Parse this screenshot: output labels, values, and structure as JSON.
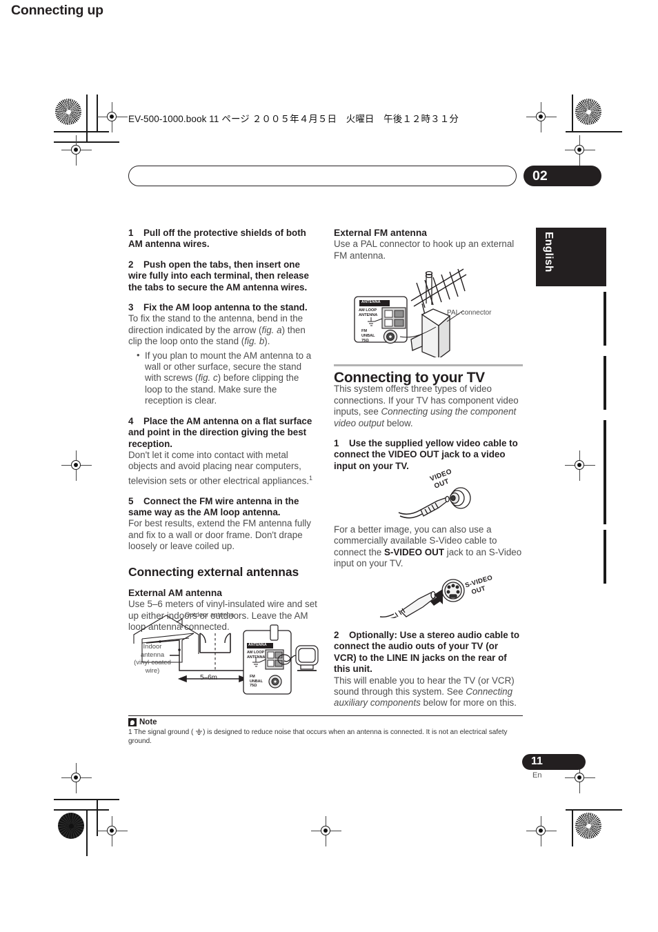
{
  "file_header": "EV-500-1000.book  11 ページ  ２００５年４月５日　火曜日　午後１２時３１分",
  "banner": {
    "title": "Connecting up",
    "chapter": "02"
  },
  "side_tab": {
    "label": "English"
  },
  "left_column": {
    "steps": [
      {
        "num": "1",
        "heading": "Pull off the protective shields of both AM antenna wires."
      },
      {
        "num": "2",
        "heading": "Push open the tabs, then insert one wire fully into each terminal, then release the tabs to secure the AM antenna wires."
      },
      {
        "num": "3",
        "heading": "Fix the AM loop antenna to the stand.",
        "body_1": "To fix the stand to the antenna, bend in the direction indicated by the arrow (",
        "body_fig_a": "fig. a",
        "body_2": ") then clip the loop onto the stand (",
        "body_fig_b": "fig. b",
        "body_3": ").",
        "bullet_1": "If you plan to mount the AM antenna to a wall or other surface, secure the stand with screws (",
        "bullet_fig_c": "fig. c",
        "bullet_2": ") before clipping the loop to the stand. Make sure the reception is clear."
      },
      {
        "num": "4",
        "heading": "Place the AM antenna on a flat surface and point in the direction giving the best reception.",
        "body": "Don't let it come into contact with metal objects and avoid placing near computers, television sets or other electrical appliances.",
        "footnote_marker": "1"
      },
      {
        "num": "5",
        "heading": "Connect the FM wire antenna in the same way as the AM loop antenna.",
        "body": "For best results, extend the FM antenna fully and fix to a wall or door frame. Don't drape loosely or leave coiled up."
      }
    ],
    "section_heading": "Connecting external antennas",
    "sub_heading": "External AM antenna",
    "sub_body": "Use 5–6 meters of vinyl-insulated wire and set up either indoors or outdoors. Leave the AM loop antenna connected.",
    "figure_am": {
      "label_outdoor": "Outdoor antenna",
      "label_indoor_1": "Indoor",
      "label_indoor_2": "antenna",
      "label_indoor_3": "(vinyl-coated",
      "label_indoor_4": "wire)",
      "label_distance": "5–6m",
      "panel_title": "ANTENNA",
      "panel_am_1": "AM LOOP",
      "panel_am_2": "ANTENNA",
      "panel_fm_1": "FM",
      "panel_fm_2": "UNBAL",
      "panel_fm_3": "75Ω"
    }
  },
  "right_column": {
    "fm_heading": "External FM antenna",
    "fm_body": "Use a PAL connector to hook up an external FM antenna.",
    "figure_fm": {
      "panel_title": "ANTENNA",
      "panel_am_1": "AM LOOP",
      "panel_am_2": "ANTENNA",
      "panel_fm_1": "FM",
      "panel_fm_2": "UNBAL",
      "panel_fm_3": "75Ω",
      "callout": "PAL connector"
    },
    "tv_heading": "Connecting to your TV",
    "tv_body_1": "This system offers three types of video connections. If your TV has component video inputs, see ",
    "tv_body_italic": "Connecting using the component video output",
    "tv_body_2": " below.",
    "step1": {
      "num": "1",
      "heading": "Use the supplied yellow video cable to connect the VIDEO OUT jack to a video input on your TV."
    },
    "figure_video": {
      "label_1": "VIDEO",
      "label_2": "OUT"
    },
    "svideo_body_1": "For a better image, you can also use a commercially available S-Video cable to connect the ",
    "svideo_bold": "S-VIDEO OUT",
    "svideo_body_2": " jack to an S-Video input on your TV.",
    "figure_svideo": {
      "label_1": "S-VIDEO",
      "label_2": "OUT"
    },
    "step2": {
      "num": "2",
      "heading": "Optionally: Use a stereo audio cable to connect the audio outs of your TV (or VCR) to the LINE IN jacks on the rear of this unit.",
      "body_1": "This will enable you to hear the TV (or VCR) sound through this system. See ",
      "body_italic": "Connecting auxiliary components",
      "body_2": " below for more on this."
    }
  },
  "note": {
    "title": "Note",
    "marker": "1",
    "text_1": " The signal ground ( ",
    "text_2": ") is designed to reduce noise that occurs when an antenna is connected. It is not an electrical safety ground."
  },
  "folio": {
    "page": "11",
    "lang": "En"
  }
}
